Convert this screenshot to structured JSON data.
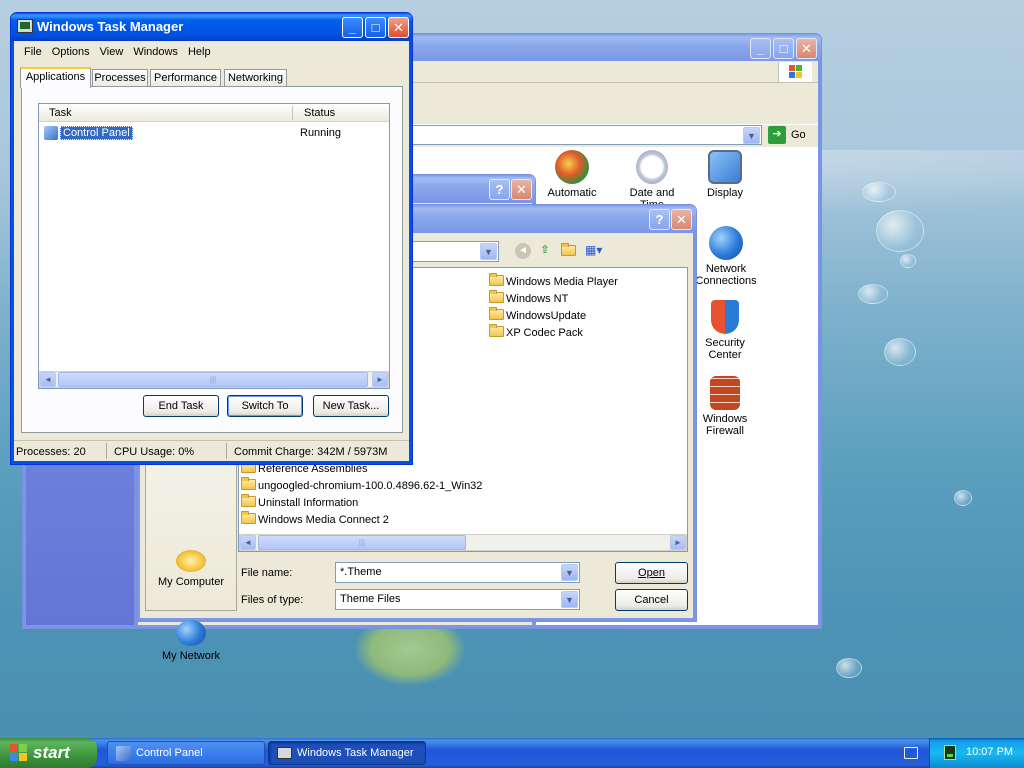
{
  "taskmgr": {
    "title": "Windows Task Manager",
    "menu": [
      "File",
      "Options",
      "View",
      "Windows",
      "Help"
    ],
    "tabs": [
      "Applications",
      "Processes",
      "Performance",
      "Networking"
    ],
    "columns": {
      "task": "Task",
      "status": "Status"
    },
    "rows": [
      {
        "task": "Control Panel",
        "status": "Running"
      }
    ],
    "buttons": {
      "end_task": "End Task",
      "switch_to": "Switch To",
      "new_task": "New Task..."
    },
    "status": {
      "processes": "Processes: 20",
      "cpu": "CPU Usage: 0%",
      "commit": "Commit Charge: 342M / 5973M"
    }
  },
  "control_panel": {
    "go_label": "Go",
    "icons": [
      {
        "label": "Automatic",
        "name": "automatic-updates-icon"
      },
      {
        "label": "Date and Time",
        "name": "date-time-icon"
      },
      {
        "label": "Display",
        "name": "display-icon"
      },
      {
        "label": "Network Connections",
        "name": "network-connections-icon"
      },
      {
        "label": "Security Center",
        "name": "security-center-icon"
      },
      {
        "label": "Windows Firewall",
        "name": "windows-firewall-icon"
      }
    ]
  },
  "open_dialog": {
    "folders_right": [
      "Windows Media Player",
      "Windows NT",
      "WindowsUpdate",
      "XP Codec Pack"
    ],
    "folders_bottom": [
      "Reference Assemblies",
      "ungoogled-chromium-100.0.4896.62-1_Win32",
      "Uninstall Information",
      "Windows Media Connect 2"
    ],
    "places": [
      "My Computer",
      "My Network"
    ],
    "file_name_label": "File name:",
    "file_name_value": "*.Theme",
    "file_type_label": "Files of type:",
    "file_type_value": "Theme Files",
    "open_label": "Open",
    "cancel_label": "Cancel"
  },
  "taskbar": {
    "start_label": "start",
    "items": [
      "Control Panel",
      "Windows Task Manager"
    ],
    "clock": "10:07 PM"
  },
  "colors": {
    "xp_blue": "#0054e3",
    "selection": "#316ac5",
    "start_green": "#3d943d"
  }
}
